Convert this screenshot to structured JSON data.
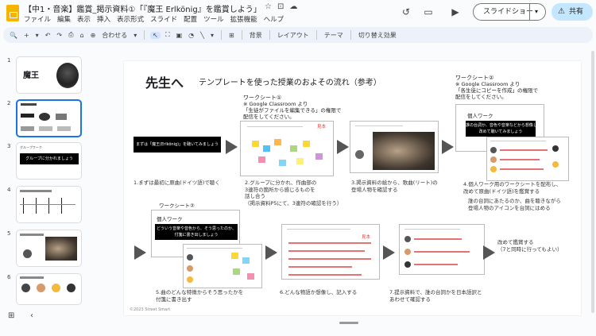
{
  "header": {
    "doc_title": "【中1・音楽】鑑賞_掲示資料①「『魔王 Erlkönig』を鑑賞しよう」",
    "title_icons": [
      "☆",
      "⊡",
      "☁"
    ],
    "menu": [
      "ファイル",
      "編集",
      "表示",
      "挿入",
      "表示形式",
      "スライド",
      "配置",
      "ツール",
      "拡張機能",
      "ヘルプ"
    ],
    "slideshow_label": "スライドショー",
    "share_label": "共有"
  },
  "toolbar": {
    "search": "🔍",
    "add": "+",
    "fit": "合わせる",
    "background": "背景",
    "layout": "レイアウト",
    "theme": "テーマ",
    "transition": "切り替え効果"
  },
  "filmstrip": {
    "numbers": [
      "1",
      "2",
      "3",
      "4",
      "5",
      "6"
    ],
    "slide1_title": "魔王",
    "slide3_label": "グループワーク",
    "slide3_bar": "グループに分かれましょう"
  },
  "slide": {
    "heading": "先生へ",
    "subheading": "テンプレートを使った授業のおよその流れ（参考）",
    "ws1_title": "ワークシート①",
    "ws1_note": "※ Google Classroom より\n「生徒がファイルを編集できる」の権限で\n配信をしてください。",
    "ws2_title": "ワークシート②",
    "ws2_note": "※ Google Classroom より\n「各生徒にコピーを作成」の権限で\n配信をしてください。",
    "ws2b_title": "ワークシート②",
    "step1_bar": "まずは「魔王(Erlkönig)」を聴いてみましょう",
    "step1": "1.まずは最初に原曲(ドイツ語)で聴く",
    "step2": "2.グループに分かれ、作曲部の\n3連符の箇所から感じるものを\n話し合う\n（掲示資料P5にて、3連符の確認を行う）",
    "step3": "3.掲示資料の絵から、歌曲(リート)の\n登場人物を確認する",
    "step4": "4.個人ワーク用のワークシートを配布し、\n改めて原曲(ドイツ語)を鑑賞する",
    "step4_note": "誰の台詞にあたるのか、曲を聴きながら\n登場人物のアイコンを台詞にはめる",
    "step4_bar": "誰の台詞か、音色や音楽などから想像して\n改めて聴いてみましょう",
    "personal": "個人ワーク",
    "step5_bar": "どういう音楽や音色から、そう思ったのか、\n付箋に書き出しましょう",
    "step5": "5.曲のどんな特徴からそう思ったかを\n付箋に書き出す",
    "step6": "6.どんな物語か想像し、記入する",
    "step7": "7.提示資料で、誰の台詞かを日本語訳と\nあわせて確認する",
    "step8": "改めて鑑賞する\n（7と同時に行ってもよい）",
    "sample": "見本",
    "copyright": "©2023 Street Smart"
  }
}
